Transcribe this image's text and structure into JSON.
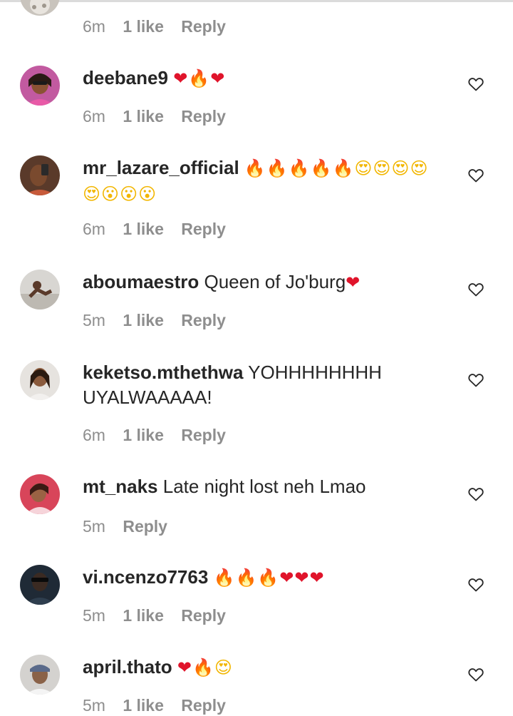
{
  "partial_comment": {
    "time": "6m",
    "likes": "1 like",
    "reply": "Reply"
  },
  "comments": [
    {
      "username": "deebane9",
      "text": "",
      "emojis": "❤🔥❤",
      "time": "6m",
      "likes": "1 like",
      "reply": "Reply"
    },
    {
      "username": "mr_lazare_official",
      "text": "",
      "emojis": "🔥🔥🔥🔥🔥😍😍😍😍😍😮😮😮",
      "time": "6m",
      "likes": "1 like",
      "reply": "Reply"
    },
    {
      "username": "aboumaestro",
      "text": "Queen of Jo'burg",
      "emojis": "❤",
      "time": "5m",
      "likes": "1 like",
      "reply": "Reply"
    },
    {
      "username": "keketso.mthethwa",
      "text": "YOHHHHHHHH UYALWAAAAA!",
      "emojis": "",
      "time": "6m",
      "likes": "1 like",
      "reply": "Reply"
    },
    {
      "username": "mt_naks",
      "text": "Late night lost neh Lmao",
      "emojis": "",
      "time": "5m",
      "likes": "",
      "reply": "Reply"
    },
    {
      "username": "vi.ncenzo7763",
      "text": "",
      "emojis": "🔥🔥🔥❤❤❤",
      "time": "5m",
      "likes": "1 like",
      "reply": "Reply"
    },
    {
      "username": "april.thato",
      "text": "",
      "emojis": "❤🔥😍",
      "time": "5m",
      "likes": "1 like",
      "reply": "Reply"
    }
  ],
  "icons": {
    "like": "heart-outline-icon",
    "avatar": "profile-avatar"
  },
  "colors": {
    "username": "#262626",
    "meta": "#8e8e8e",
    "heart_icon": "#262626",
    "emoji_heart": "#e0142b",
    "emoji_fire": "#f57c00"
  }
}
